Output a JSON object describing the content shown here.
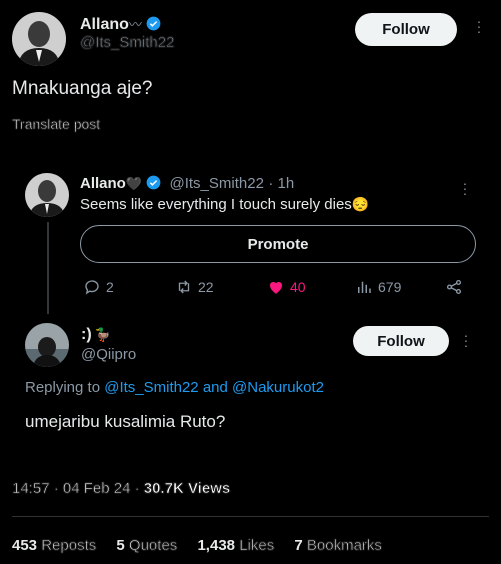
{
  "main_tweet": {
    "name": "Allano",
    "name_emoji": "〰",
    "handle": "@Its_Smith22",
    "text": "Mnakuanga aje?",
    "translate_label": "Translate post",
    "follow_label": "Follow"
  },
  "quoted_reply": {
    "name": "Allano",
    "name_emoji": "🖤",
    "handle": "@Its_Smith22",
    "time": "· 1h",
    "text": "Seems like everything I touch surely dies",
    "text_emoji": "😔",
    "promote_label": "Promote",
    "stats": {
      "replies": "2",
      "reposts": "22",
      "likes": "40",
      "views": "679"
    }
  },
  "reply_tweet": {
    "name": ":)",
    "name_emoji": "🦆",
    "handle": "@Qiipro",
    "follow_label": "Follow",
    "replying_prefix": "Replying to ",
    "replying_user1": "@Its_Smith22",
    "replying_and": " and ",
    "replying_user2": "@Nakurukot2",
    "text": "umejaribu kusalimia Ruto?"
  },
  "meta": {
    "timestamp": "14:57 · 04 Feb 24 · ",
    "views": "30.7K Views"
  },
  "engagement": {
    "reposts_count": "453",
    "reposts_label": "Reposts",
    "quotes_count": "5",
    "quotes_label": "Quotes",
    "likes_count": "1,438",
    "likes_label": "Likes",
    "bookmarks_count": "7",
    "bookmarks_label": "Bookmarks"
  },
  "colors": {
    "background": "#000000",
    "accent_blue": "#1d9bf0",
    "like_pink": "#f91880",
    "muted": "#8b98a5"
  }
}
